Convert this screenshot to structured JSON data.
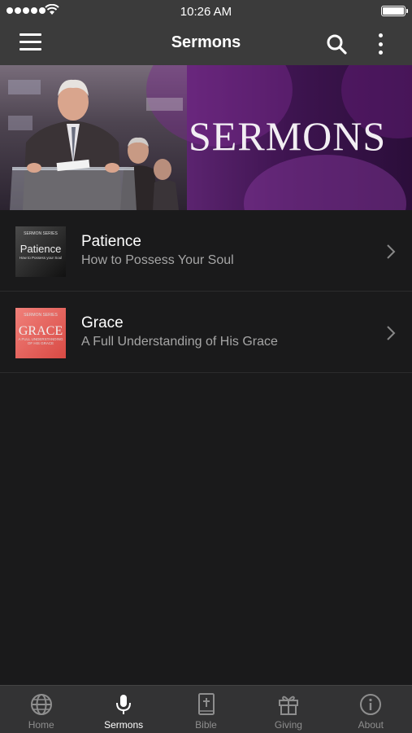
{
  "status": {
    "time": "10:26 AM"
  },
  "nav": {
    "title": "Sermons"
  },
  "banner": {
    "title": "SERMONS"
  },
  "sermons": [
    {
      "title": "Patience",
      "subtitle": "How to Possess Your Soul",
      "thumb": {
        "series": "SERMON SERIES",
        "main": "Patience",
        "sub": "How to Possess your Soul"
      }
    },
    {
      "title": "Grace",
      "subtitle": "A Full Understanding of His Grace",
      "thumb": {
        "series": "SERMON SERIES",
        "main": "GRACE",
        "sub": "A FULL UNDERSTANDING OF HIS GRACE"
      }
    }
  ],
  "tabs": [
    {
      "label": "Home",
      "icon": "globe-icon"
    },
    {
      "label": "Sermons",
      "icon": "microphone-icon"
    },
    {
      "label": "Bible",
      "icon": "bible-icon"
    },
    {
      "label": "Giving",
      "icon": "gift-icon"
    },
    {
      "label": "About",
      "icon": "info-icon"
    }
  ],
  "colors": {
    "bar": "#3b3b3b",
    "background": "#1a1a1b",
    "tabActive": "#ffffff",
    "tabInactive": "#8e8e8e"
  }
}
